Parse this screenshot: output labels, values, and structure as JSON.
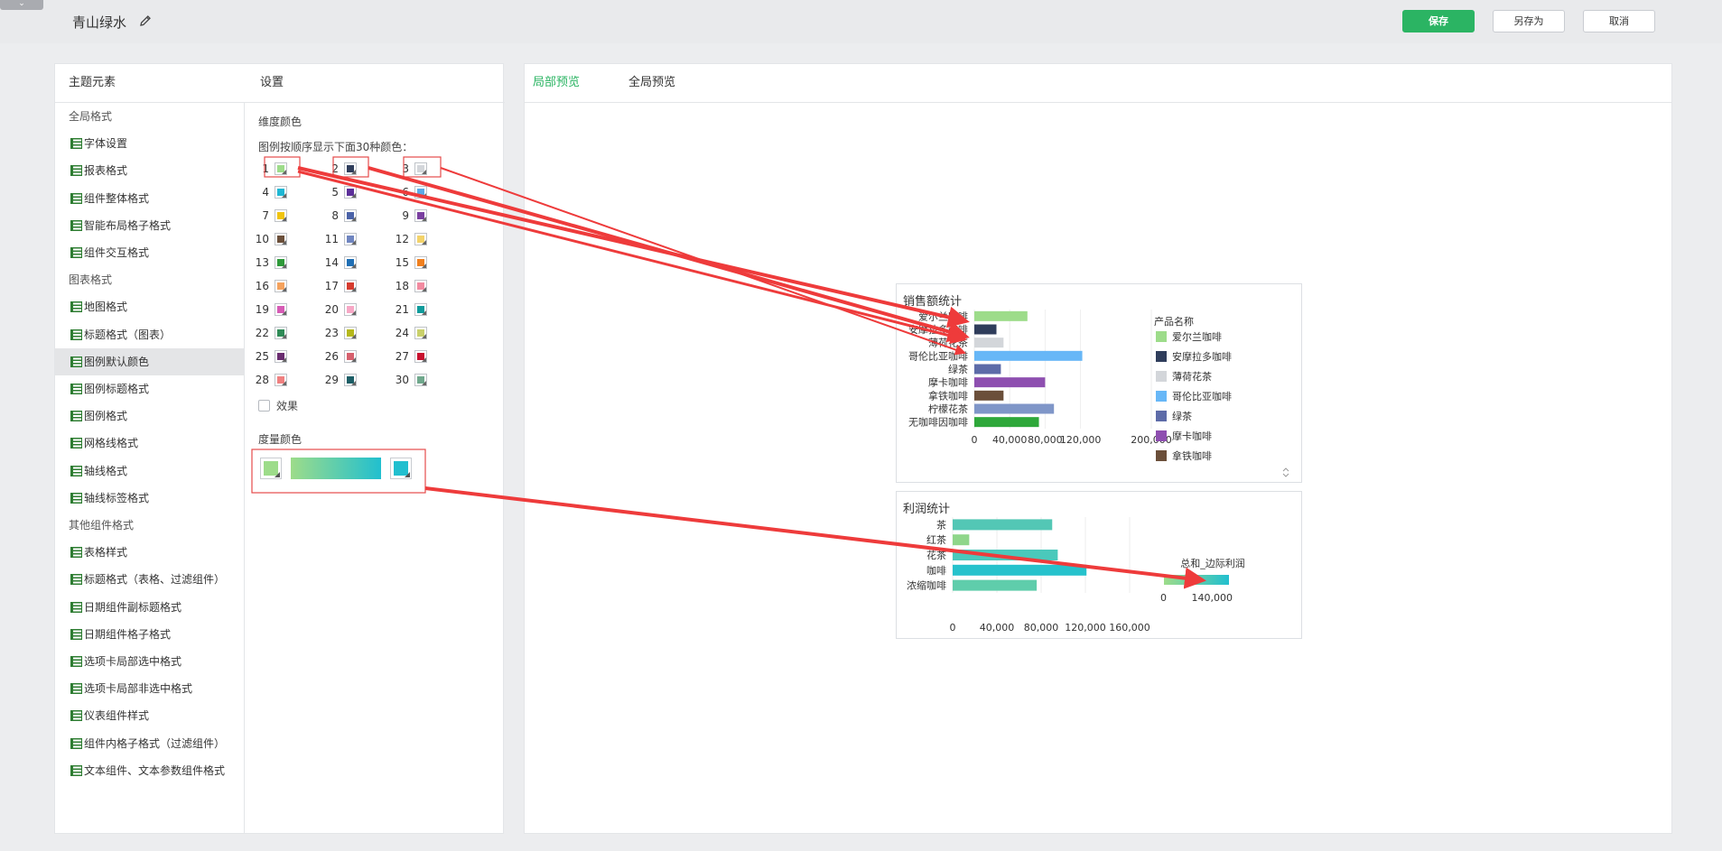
{
  "header": {
    "theme_name": "青山绿水",
    "save_label": "保存",
    "save_as_label": "另存为",
    "cancel_label": "取消"
  },
  "left_panel": {
    "nav_header": "主题元素",
    "settings_header": "设置",
    "nav_items": [
      {
        "label": "全局格式",
        "type": "group"
      },
      {
        "label": "字体设置",
        "type": "sub"
      },
      {
        "label": "报表格式",
        "type": "sub"
      },
      {
        "label": "组件整体格式",
        "type": "sub"
      },
      {
        "label": "智能布局格子格式",
        "type": "sub"
      },
      {
        "label": "组件交互格式",
        "type": "sub"
      },
      {
        "label": "图表格式",
        "type": "group"
      },
      {
        "label": "地图格式",
        "type": "sub"
      },
      {
        "label": "标题格式（图表）",
        "type": "sub"
      },
      {
        "label": "图例默认颜色",
        "type": "sub",
        "active": true
      },
      {
        "label": "图例标题格式",
        "type": "sub"
      },
      {
        "label": "图例格式",
        "type": "sub"
      },
      {
        "label": "网格线格式",
        "type": "sub"
      },
      {
        "label": "轴线格式",
        "type": "sub"
      },
      {
        "label": "轴线标签格式",
        "type": "sub"
      },
      {
        "label": "其他组件格式",
        "type": "group"
      },
      {
        "label": "表格样式",
        "type": "sub"
      },
      {
        "label": "标题格式（表格、过滤组件）",
        "type": "sub"
      },
      {
        "label": "日期组件副标题格式",
        "type": "sub"
      },
      {
        "label": "日期组件格子格式",
        "type": "sub"
      },
      {
        "label": "选项卡局部选中格式",
        "type": "sub"
      },
      {
        "label": "选项卡局部非选中格式",
        "type": "sub"
      },
      {
        "label": "仪表组件样式",
        "type": "sub"
      },
      {
        "label": "组件内格子格式（过滤组件）",
        "type": "sub"
      },
      {
        "label": "文本组件、文本参数组件格式",
        "type": "sub"
      }
    ],
    "settings": {
      "dimension_color_label": "维度颜色",
      "legend_hint": "图例按顺序显示下面30种颜色：",
      "effect_label": "效果",
      "measure_color_label": "度量颜色",
      "gradient_start": "#9ddc8a",
      "gradient_end": "#21bfcf"
    }
  },
  "palette": [
    {
      "n": "1",
      "color": "#9ddc8a"
    },
    {
      "n": "2",
      "color": "#2f3d5b"
    },
    {
      "n": "3",
      "color": "#d3d6da"
    },
    {
      "n": "4",
      "color": "#1fb7d4"
    },
    {
      "n": "5",
      "color": "#5c2f9a"
    },
    {
      "n": "6",
      "color": "#5aa9e6"
    },
    {
      "n": "7",
      "color": "#f1c40f"
    },
    {
      "n": "8",
      "color": "#4a62a8"
    },
    {
      "n": "9",
      "color": "#7a3fa0"
    },
    {
      "n": "10",
      "color": "#6b4f3a"
    },
    {
      "n": "11",
      "color": "#6f85c0"
    },
    {
      "n": "12",
      "color": "#f3d36a"
    },
    {
      "n": "13",
      "color": "#2e9a3a"
    },
    {
      "n": "14",
      "color": "#1f6fb5"
    },
    {
      "n": "15",
      "color": "#f07f1e"
    },
    {
      "n": "16",
      "color": "#f5a25d"
    },
    {
      "n": "17",
      "color": "#d63b2e"
    },
    {
      "n": "18",
      "color": "#f28aa0"
    },
    {
      "n": "19",
      "color": "#d65bb5"
    },
    {
      "n": "20",
      "color": "#f7a8c6"
    },
    {
      "n": "21",
      "color": "#0f9b9b"
    },
    {
      "n": "22",
      "color": "#2e8b57"
    },
    {
      "n": "23",
      "color": "#b5b81c"
    },
    {
      "n": "24",
      "color": "#c9d06a"
    },
    {
      "n": "25",
      "color": "#6a2c70"
    },
    {
      "n": "26",
      "color": "#d6606d"
    },
    {
      "n": "27",
      "color": "#c8102e"
    },
    {
      "n": "28",
      "color": "#f08080"
    },
    {
      "n": "29",
      "color": "#1c5e66"
    },
    {
      "n": "30",
      "color": "#6fa88c"
    }
  ],
  "preview": {
    "local_tab": "局部预览",
    "global_tab": "全局预览"
  },
  "chart_data": [
    {
      "type": "bar",
      "title": "销售额统计",
      "orientation": "horizontal",
      "categories": [
        "爱尔兰咖啡",
        "安摩拉多咖啡",
        "薄荷花茶",
        "哥伦比亚咖啡",
        "绿茶",
        "摩卡咖啡",
        "拿铁咖啡",
        "柠檬花茶",
        "无咖啡因咖啡"
      ],
      "values": [
        60000,
        25000,
        33000,
        122000,
        30000,
        80000,
        33000,
        90000,
        73000
      ],
      "colors": [
        "#9ddc8a",
        "#2f3d5b",
        "#d3d6da",
        "#67b7f7",
        "#5d6ba8",
        "#8e4fb0",
        "#6b4f3a",
        "#7f96c8",
        "#2ea83a"
      ],
      "xlim": [
        0,
        200000
      ],
      "x_ticks": [
        "0",
        "40,000",
        "80,000",
        "120,000",
        "200,000"
      ],
      "legend_title": "产品名称",
      "legend": [
        "爱尔兰咖啡",
        "安摩拉多咖啡",
        "薄荷花茶",
        "哥伦比亚咖啡",
        "绿茶",
        "摩卡咖啡",
        "拿铁咖啡"
      ],
      "legend_position": "right"
    },
    {
      "type": "bar",
      "title": "利润统计",
      "orientation": "horizontal",
      "categories": [
        "茶",
        "红茶",
        "花茶",
        "咖啡",
        "浓缩咖啡"
      ],
      "values": [
        90000,
        15000,
        95000,
        121000,
        76000
      ],
      "colors": [
        "#53c7b5",
        "#8fd68a",
        "#4ac9bb",
        "#26c2cc",
        "#5fcdab"
      ],
      "xlim": [
        0,
        160000
      ],
      "x_ticks": [
        "0",
        "40,000",
        "80,000",
        "120,000",
        "160,000"
      ],
      "legend_title": "总和_边际利润",
      "legend_min": "0",
      "legend_max": "140,000",
      "legend_position": "right"
    }
  ]
}
